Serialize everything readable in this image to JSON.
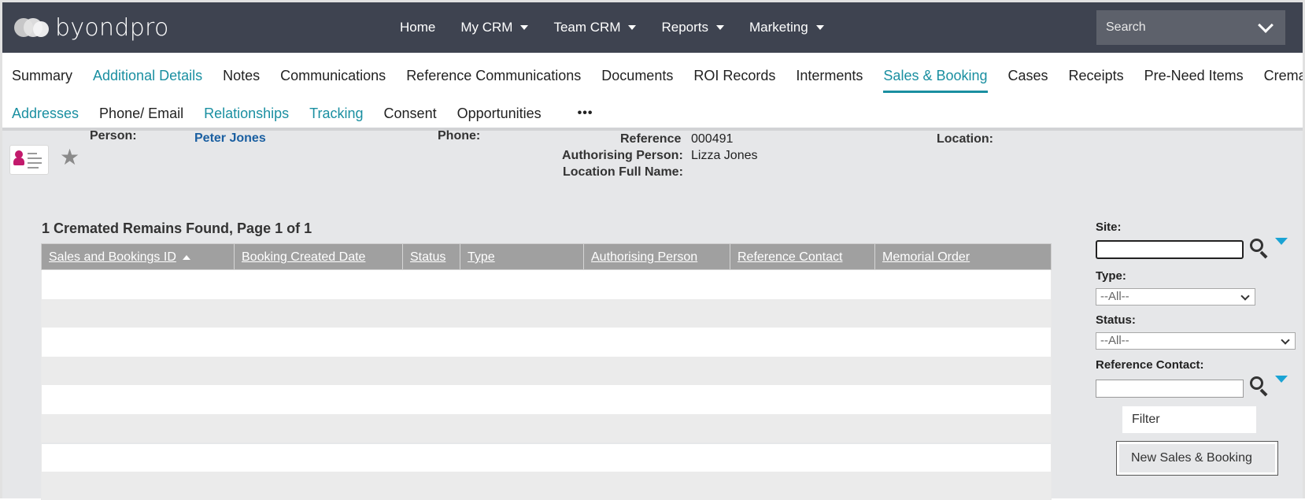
{
  "header": {
    "logo_text": "byondpro",
    "nav": [
      {
        "label": "Home",
        "dropdown": false
      },
      {
        "label": "My CRM",
        "dropdown": true
      },
      {
        "label": "Team CRM",
        "dropdown": true
      },
      {
        "label": "Reports",
        "dropdown": true
      },
      {
        "label": "Marketing",
        "dropdown": true
      }
    ],
    "search_placeholder": "Search"
  },
  "tabs_row1": [
    {
      "label": "Summary",
      "style": "plain"
    },
    {
      "label": "Additional Details",
      "style": "link"
    },
    {
      "label": "Notes",
      "style": "plain"
    },
    {
      "label": "Communications",
      "style": "plain"
    },
    {
      "label": "Reference Communications",
      "style": "plain"
    },
    {
      "label": "Documents",
      "style": "plain"
    },
    {
      "label": "ROI Records",
      "style": "plain"
    },
    {
      "label": "Interments",
      "style": "plain"
    },
    {
      "label": "Sales & Booking",
      "style": "active"
    },
    {
      "label": "Cases",
      "style": "plain"
    },
    {
      "label": "Receipts",
      "style": "plain"
    },
    {
      "label": "Pre-Need Items",
      "style": "plain"
    },
    {
      "label": "Cremated Remains",
      "style": "plain"
    }
  ],
  "tabs_row2": [
    {
      "label": "Addresses",
      "style": "link"
    },
    {
      "label": "Phone/ Email",
      "style": "plain"
    },
    {
      "label": "Relationships",
      "style": "link"
    },
    {
      "label": "Tracking",
      "style": "link"
    },
    {
      "label": "Consent",
      "style": "plain"
    },
    {
      "label": "Opportunities",
      "style": "plain"
    },
    {
      "label": "•••",
      "style": "more"
    }
  ],
  "record": {
    "person_label": "Person:",
    "person_value": "Peter Jones",
    "phone_label": "Phone:",
    "reference_label": "Reference",
    "reference_value": "000491",
    "authorising_label": "Authorising Person:",
    "authorising_value": "Lizza Jones",
    "location_full_label": "Location Full Name:",
    "location_label": "Location:"
  },
  "results": {
    "summary": "1 Cremated Remains Found, Page 1 of 1",
    "columns": [
      "Sales and Bookings ID",
      "Booking Created Date",
      "Status",
      "Type",
      "Authorising Person",
      "Reference Contact",
      "Memorial Order"
    ],
    "sorted_column": "Sales and Bookings ID",
    "sort_direction": "ascending"
  },
  "filters": {
    "site_label": "Site:",
    "site_value": "",
    "type_label": "Type:",
    "type_value": "--All--",
    "status_label": "Status:",
    "status_value": "--All--",
    "reference_contact_label": "Reference Contact:",
    "reference_contact_value": "",
    "filter_button": "Filter",
    "new_button": "New Sales & Booking"
  },
  "colors": {
    "header_bg": "#3e4350",
    "accent": "#1a8fa1",
    "grid_header": "#a0a0a0",
    "dropdown_triangle": "#1aa3d4"
  }
}
